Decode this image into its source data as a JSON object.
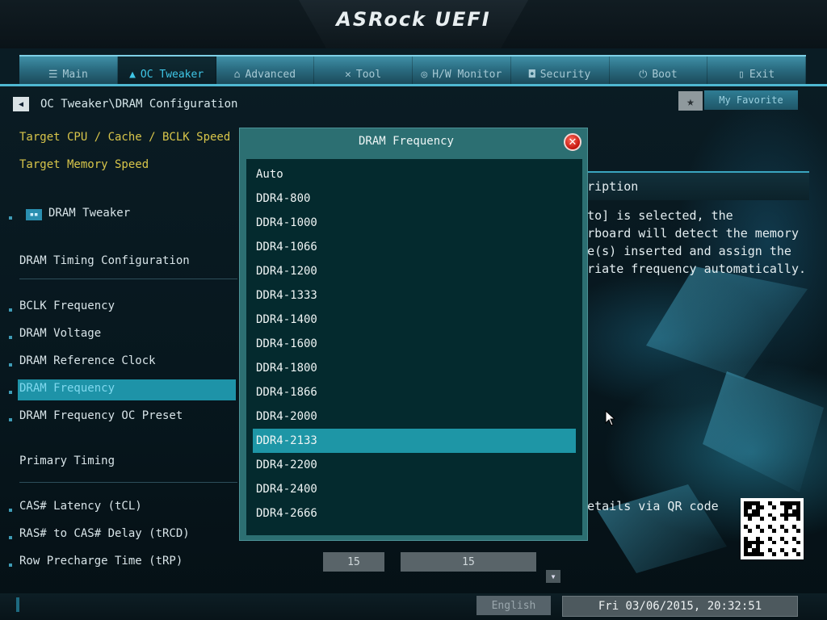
{
  "header": {
    "brand": "ASRock UEFI"
  },
  "tabs": [
    {
      "label": "Main",
      "icon": "list-icon",
      "glyph": "☰"
    },
    {
      "label": "OC Tweaker",
      "icon": "flame-icon",
      "glyph": "▲"
    },
    {
      "label": "Advanced",
      "icon": "advanced-icon",
      "glyph": "⌂"
    },
    {
      "label": "Tool",
      "icon": "tool-icon",
      "glyph": "✕"
    },
    {
      "label": "H/W Monitor",
      "icon": "monitor-icon",
      "glyph": "◎"
    },
    {
      "label": "Security",
      "icon": "shield-icon",
      "glyph": "◘"
    },
    {
      "label": "Boot",
      "icon": "power-icon",
      "glyph": "⏻"
    },
    {
      "label": "Exit",
      "icon": "exit-icon",
      "glyph": "▯"
    }
  ],
  "breadcrumb": {
    "path": "OC Tweaker\\DRAM Configuration"
  },
  "favorite": {
    "label": "My Favorite"
  },
  "left": {
    "target_cpu": "Target CPU / Cache / BCLK Speed",
    "target_mem": "Target Memory Speed",
    "dram_tweaker": "DRAM Tweaker",
    "timing_config": "DRAM Timing Configuration",
    "bclk": "BCLK Frequency",
    "voltage": "DRAM Voltage",
    "ref_clock": "DRAM Reference Clock",
    "dram_freq": "DRAM Frequency",
    "oc_preset": "DRAM Frequency OC Preset",
    "primary": "Primary Timing",
    "cas": "CAS# Latency (tCL)",
    "ras_cas": "RAS# to CAS# Delay (tRCD)",
    "row_pre": "Row Precharge Time (tRP)"
  },
  "values": {
    "trp_current": "15",
    "trp_setting": "15"
  },
  "description": {
    "title": "escription",
    "lines": [
      "[Auto] is selected, the",
      "therboard will detect the memory",
      "dule(s) inserted and assign the",
      "ropriate frequency automatically."
    ],
    "qr_label": "t details via QR code"
  },
  "footer": {
    "language": "English",
    "datetime": "Fri 03/06/2015, 20:32:51"
  },
  "modal": {
    "title": "DRAM Frequency",
    "options": [
      "Auto",
      "DDR4-800",
      "DDR4-1000",
      "DDR4-1066",
      "DDR4-1200",
      "DDR4-1333",
      "DDR4-1400",
      "DDR4-1600",
      "DDR4-1800",
      "DDR4-1866",
      "DDR4-2000",
      "DDR4-2133",
      "DDR4-2200",
      "DDR4-2400",
      "DDR4-2666"
    ],
    "selected_index": 11
  },
  "colors": {
    "accent": "#1e96a6",
    "selected_left": "#1e93a8",
    "yellow_label": "#d8c54a"
  }
}
